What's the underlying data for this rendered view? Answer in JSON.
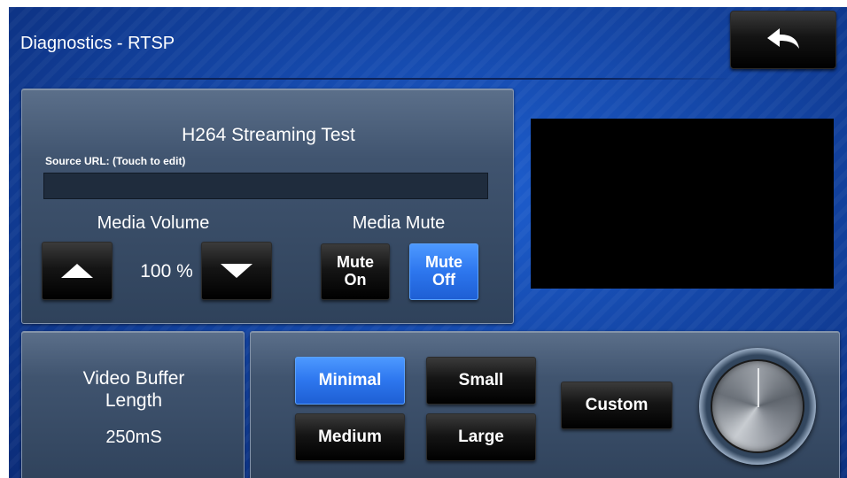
{
  "header": {
    "title": "Diagnostics - RTSP",
    "back_icon": "back-arrow-icon"
  },
  "streaming": {
    "title": "H264 Streaming Test",
    "source_url_label": "Source URL: (Touch to edit)",
    "source_url_value": ""
  },
  "volume": {
    "label": "Media Volume",
    "value": "100 %",
    "up_icon": "triangle-up-icon",
    "down_icon": "triangle-down-icon"
  },
  "mute": {
    "label": "Media Mute",
    "on_line1": "Mute",
    "on_line2": "On",
    "off_line1": "Mute",
    "off_line2": "Off",
    "selected": "Off"
  },
  "buffer": {
    "title_line1": "Video Buffer",
    "title_line2": "Length",
    "value": "250mS",
    "options": [
      "Minimal",
      "Small",
      "Medium",
      "Large",
      "Custom"
    ],
    "selected": "Minimal"
  },
  "colors": {
    "active_button": "#2d76ee",
    "background": "#1446a6",
    "button": "#000000"
  }
}
